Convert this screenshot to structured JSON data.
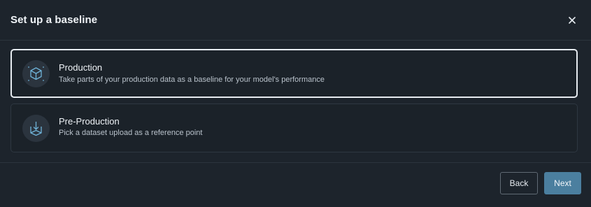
{
  "dialog": {
    "title": "Set up a baseline",
    "close_icon": "close-icon"
  },
  "options": [
    {
      "title": "Production",
      "description": "Take parts of your production data as a baseline for your model's performance",
      "icon": "cube-icon",
      "selected": true
    },
    {
      "title": "Pre-Production",
      "description": "Pick a dataset upload as a reference point",
      "icon": "box-download-icon",
      "selected": false
    }
  ],
  "footer": {
    "back_label": "Back",
    "next_label": "Next"
  },
  "colors": {
    "accent": "#4b7f9f",
    "icon_stroke": "#6fb3d8",
    "selected_border": "#e6ebf0",
    "background": "#1d242c"
  }
}
